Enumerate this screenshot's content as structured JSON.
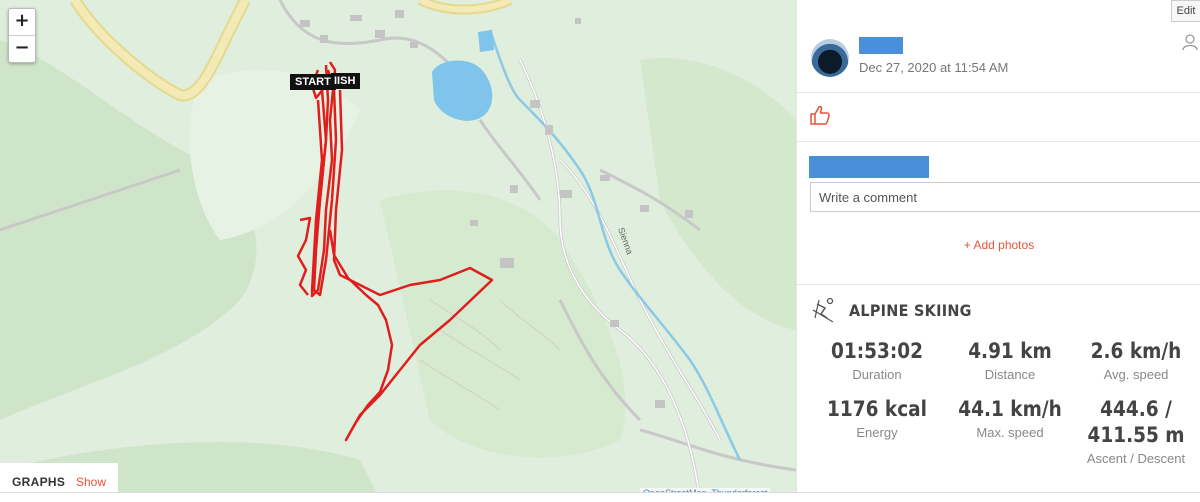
{
  "map": {
    "zoom_in": "+",
    "zoom_out": "−",
    "start_label": "START",
    "finish_label": "IISH",
    "road_label": "Sienna",
    "attribution": "OpenStreetMap, Thunderforest",
    "route_color": "#e01e1e",
    "graphs_label": "GRAPHS",
    "graphs_show": "Show"
  },
  "panel": {
    "edit_label": "Edit",
    "date": "Dec 27, 2020 at 11:54 AM",
    "comment_placeholder": "Write a comment",
    "add_photos": "+ Add photos",
    "activity_title": "ALPINE SKIING",
    "accent_color": "#e8533a",
    "stats": [
      {
        "value": "01:53:02",
        "label": "Duration"
      },
      {
        "value": "4.91 km",
        "label": "Distance"
      },
      {
        "value": "2.6 km/h",
        "label": "Avg. speed"
      },
      {
        "value": "1176 kcal",
        "label": "Energy"
      },
      {
        "value": "44.1 km/h",
        "label": "Max. speed"
      },
      {
        "value": "444.6 /",
        "value2": "411.55 m",
        "label": "Ascent / Descent"
      }
    ]
  }
}
